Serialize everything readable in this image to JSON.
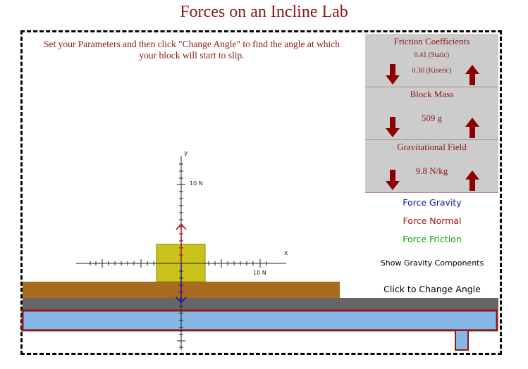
{
  "title": "Forces on an Incline Lab",
  "instructions": "Set your Parameters and then click \"Change Angle\" to find the angle at which your block will start to slip.",
  "friction": {
    "title": "Friction Coefficients",
    "static": "0.41 (Static)",
    "kinetic": "0.30 (Kinetic)"
  },
  "mass": {
    "title": "Block Mass",
    "value": "509 g"
  },
  "gravity": {
    "title": "Gravitational Field",
    "value": "9.8 N/kg"
  },
  "legend": {
    "gravity": "Force Gravity",
    "normal": "Force Normal",
    "friction": "Force Friction"
  },
  "buttons": {
    "components": "Show Gravity Components",
    "change_angle": "Click to Change Angle"
  },
  "axes": {
    "y_label": "y",
    "x_label": "x",
    "y_tick": "10 N",
    "x_tick": "10 N"
  },
  "colors": {
    "title": "#8b1a1a",
    "panel": "#cccccc",
    "arrow": "#8b0000",
    "gravity": "#1a1aa0",
    "normal": "#b01010",
    "friction": "#10a010",
    "block": "#c9c21a",
    "board": "#a86a1e",
    "slab": "#666666",
    "base": "#85b8e6"
  }
}
